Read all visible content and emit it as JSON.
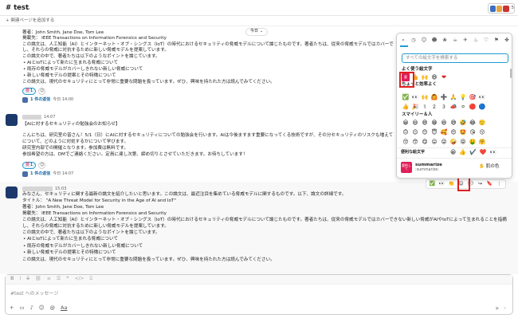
{
  "header": {
    "channel": "# test",
    "member_count": "5"
  },
  "bookmark": {
    "label": "+ 関連ページを追加する"
  },
  "date_chip": {
    "label": "今日"
  },
  "msg1": {
    "lines": [
      "著者：John Smith, Jane Doe, Tom Lee",
      "掲載先： IEEE Transactions on Information Forensics and Security",
      "この論文は、人工知能（AI）とインターネット・オブ・シングス（IoT）の時代におけるセキュリティの脅威モデルについて論じたものです。著者たちは、従来の脅威モデルではカバーで",
      "し、それらの脅威に対抗するために新しい脅威モデルを提案しています。",
      "この論文の中で、著者たちは以下のようなポイントを論じています。"
    ],
    "bullets": [
      "AIとIoTによって新たに生まれる脅威について",
      "既存の脅威モデルがカバーしきれない新しい脅威について",
      "新しい脅威モデルの提案とその特徴について"
    ],
    "closing": "この論文は、現代のセキュリティにとって非常に重要な問題を扱っています。ぜひ、興味を持たれた方は読んでみてください。",
    "reaction_count": "1",
    "thread_count": "1 件の返信",
    "thread_time": "今日 14:00"
  },
  "msg2": {
    "time": "14:07",
    "title": "【AIに対するセキュリティの勉強会のお知らせ】",
    "lines": [
      "こんにちは、研究室の皆さん！5/1（日）にAIに対するセキュリティについての勉強会を行います。AIは今後ますます重要になってくる技術ですが、その分セキュリティのリスクも増えて",
      "について、どのように対処するかについて学びます。",
      "研究室内部での開催となります。参加費は無料です。",
      "参加希望の方は、DMでご連絡ください。定員に達し次第、締め切りとさせていただきます。お待ちしています！"
    ],
    "reaction_count": "1",
    "thread_count": "1 件の返信",
    "thread_time": "今日 14:07"
  },
  "msg3": {
    "time": "15:03",
    "lines": [
      "みなさん、セキュリティに関する最新の論文を紹介したいと思います。この論文は、最近注目を集めている脅威モデルに関するものです。以下、論文の詳細です。",
      "タイトル： \"A New Threat Model for Security in the Age of AI and IoT\"",
      "著者：John Smith, Jane Doe, Tom Lee",
      "掲載先： IEEE Transactions on Information Forensics and Security",
      "この論文は、人工知能（AI）とインターネット・オブ・シングス（IoT）の時代におけるセキュリティの脅威モデルについて論じたものです。著者たちは、従来の脅威モデルではカバーできない新しい脅威がAIやIoTによって生まれることを指摘",
      "し、それらの脅威に対抗するために新しい脅威モデルを提案しています。",
      "この論文の中で、著者たちは以下のようなポイントを論じています。"
    ],
    "bullets": [
      "AIとIoTによって新たに生まれる脅威について",
      "既存の脅威モデルがカバーしきれない新しい脅威について",
      "新しい脅威モデルの提案とその特徴について"
    ],
    "closing": "この論文は、現代のセキュリティにとって非常に重要な問題を扱っています。ぜひ、興味を持たれた方は読んでみてください。"
  },
  "picker": {
    "search_placeholder": "すべての絵文字を検索する",
    "sec_frequent": "よく使う絵文字",
    "sec_more": "ちょっと効率よく",
    "sec_smileys": "スマイリー＆人",
    "handy_label": "便利な絵文字",
    "custom_name": "summarize",
    "custom_code": ":summarize:",
    "skin_tone_label": "肌の色",
    "custom_icon_text": "要約して"
  },
  "composer": {
    "placeholder": "#test へのメッセージ"
  }
}
